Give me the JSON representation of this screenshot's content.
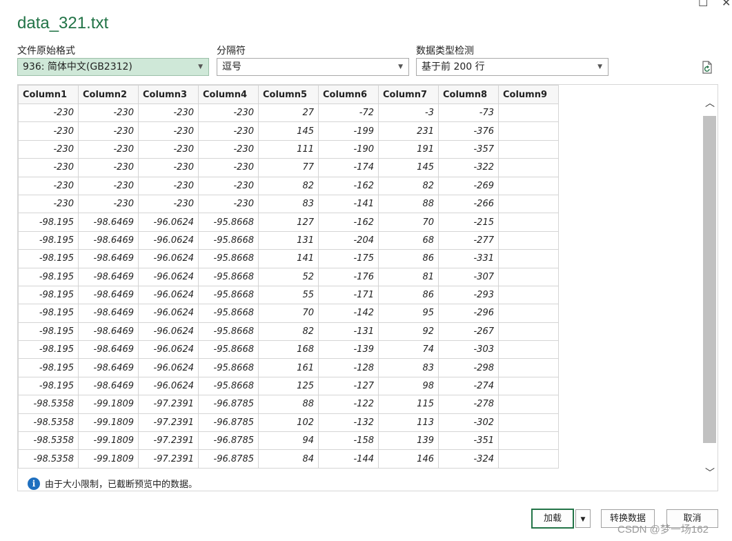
{
  "title": "data_321.txt",
  "options": {
    "file_origin": {
      "label": "文件原始格式",
      "value": "936: 简体中文(GB2312)"
    },
    "delimiter": {
      "label": "分隔符",
      "value": "逗号"
    },
    "type_detection": {
      "label": "数据类型检测",
      "value": "基于前 200 行"
    }
  },
  "table": {
    "headers": [
      "Column1",
      "Column2",
      "Column3",
      "Column4",
      "Column5",
      "Column6",
      "Column7",
      "Column8",
      "Column9"
    ],
    "rows": [
      [
        "-230",
        "-230",
        "-230",
        "-230",
        "27",
        "-72",
        "-3",
        "-73",
        ""
      ],
      [
        "-230",
        "-230",
        "-230",
        "-230",
        "145",
        "-199",
        "231",
        "-376",
        ""
      ],
      [
        "-230",
        "-230",
        "-230",
        "-230",
        "111",
        "-190",
        "191",
        "-357",
        ""
      ],
      [
        "-230",
        "-230",
        "-230",
        "-230",
        "77",
        "-174",
        "145",
        "-322",
        ""
      ],
      [
        "-230",
        "-230",
        "-230",
        "-230",
        "82",
        "-162",
        "82",
        "-269",
        ""
      ],
      [
        "-230",
        "-230",
        "-230",
        "-230",
        "83",
        "-141",
        "88",
        "-266",
        ""
      ],
      [
        "-98.195",
        "-98.6469",
        "-96.0624",
        "-95.8668",
        "127",
        "-162",
        "70",
        "-215",
        ""
      ],
      [
        "-98.195",
        "-98.6469",
        "-96.0624",
        "-95.8668",
        "131",
        "-204",
        "68",
        "-277",
        ""
      ],
      [
        "-98.195",
        "-98.6469",
        "-96.0624",
        "-95.8668",
        "141",
        "-175",
        "86",
        "-331",
        ""
      ],
      [
        "-98.195",
        "-98.6469",
        "-96.0624",
        "-95.8668",
        "52",
        "-176",
        "81",
        "-307",
        ""
      ],
      [
        "-98.195",
        "-98.6469",
        "-96.0624",
        "-95.8668",
        "55",
        "-171",
        "86",
        "-293",
        ""
      ],
      [
        "-98.195",
        "-98.6469",
        "-96.0624",
        "-95.8668",
        "70",
        "-142",
        "95",
        "-296",
        ""
      ],
      [
        "-98.195",
        "-98.6469",
        "-96.0624",
        "-95.8668",
        "82",
        "-131",
        "92",
        "-267",
        ""
      ],
      [
        "-98.195",
        "-98.6469",
        "-96.0624",
        "-95.8668",
        "168",
        "-139",
        "74",
        "-303",
        ""
      ],
      [
        "-98.195",
        "-98.6469",
        "-96.0624",
        "-95.8668",
        "161",
        "-128",
        "83",
        "-298",
        ""
      ],
      [
        "-98.195",
        "-98.6469",
        "-96.0624",
        "-95.8668",
        "125",
        "-127",
        "98",
        "-274",
        ""
      ],
      [
        "-98.5358",
        "-99.1809",
        "-97.2391",
        "-96.8785",
        "88",
        "-122",
        "115",
        "-278",
        ""
      ],
      [
        "-98.5358",
        "-99.1809",
        "-97.2391",
        "-96.8785",
        "102",
        "-132",
        "113",
        "-302",
        ""
      ],
      [
        "-98.5358",
        "-99.1809",
        "-97.2391",
        "-96.8785",
        "94",
        "-158",
        "139",
        "-351",
        ""
      ],
      [
        "-98.5358",
        "-99.1809",
        "-97.2391",
        "-96.8785",
        "84",
        "-144",
        "146",
        "-324",
        ""
      ]
    ]
  },
  "info_message": "由于大小限制，已截断预览中的数据。",
  "buttons": {
    "load": "加载",
    "transform": "转换数据",
    "cancel": "取消"
  },
  "watermark": "CSDN @梦一场162",
  "colors": {
    "accent": "#217346",
    "selected_dropdown": "#cfe8d8",
    "info_icon": "#1e6fbf"
  },
  "icons": [
    "restore-icon",
    "close-icon",
    "chevron-down-icon",
    "refresh-file-icon",
    "scroll-up-icon",
    "scroll-down-icon",
    "info-icon"
  ]
}
